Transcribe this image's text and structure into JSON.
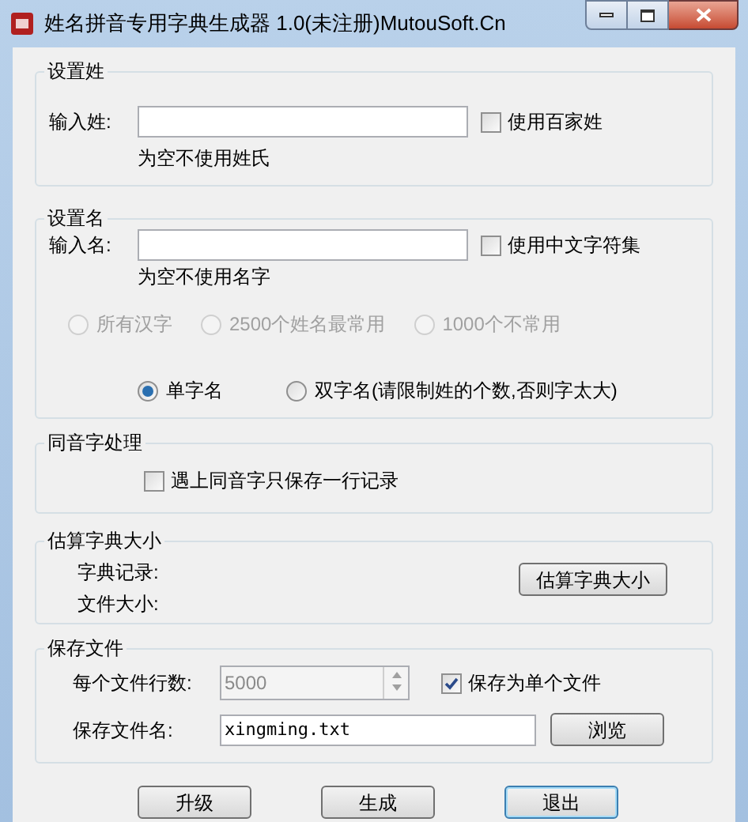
{
  "window": {
    "title": "姓名拼音专用字典生成器 1.0(未注册)MutouSoft.Cn"
  },
  "surname": {
    "title": "设置姓",
    "label": "输入姓:",
    "hint": "为空不使用姓氏",
    "checkbox": {
      "label": "使用百家姓",
      "checked": false
    }
  },
  "given_name": {
    "title": "设置名",
    "label": "输入名:",
    "hint": "为空不使用名字",
    "checkbox": {
      "label": "使用中文字符集",
      "checked": false
    },
    "charset_options": [
      {
        "label": "所有汉字",
        "selected": false,
        "disabled": true
      },
      {
        "label": "2500个姓名最常用",
        "selected": false,
        "disabled": true
      },
      {
        "label": "1000个不常用",
        "selected": false,
        "disabled": true
      }
    ],
    "length_options": [
      {
        "label": "单字名",
        "selected": true,
        "disabled": false
      },
      {
        "label": "双字名(请限制姓的个数,否则字太大)",
        "selected": false,
        "disabled": false
      }
    ]
  },
  "homophone": {
    "title": "同音字处理",
    "checkbox": {
      "label": "遇上同音字只保存一行记录",
      "checked": false
    }
  },
  "estimate": {
    "title": "估算字典大小",
    "rows": [
      {
        "label": "字典记录:"
      },
      {
        "label": "文件大小:"
      }
    ],
    "button": "估算字典大小"
  },
  "save": {
    "title": "保存文件",
    "lines_label": "每个文件行数:",
    "lines_value": "5000",
    "lines_disabled": true,
    "single_file": {
      "label": "保存为单个文件",
      "checked": true
    },
    "filename_label": "保存文件名:",
    "filename_value": "xingming.txt",
    "browse_button": "浏览"
  },
  "buttons": [
    {
      "label": "升级",
      "focused": false
    },
    {
      "label": "生成",
      "focused": false
    },
    {
      "label": "退出",
      "focused": true
    }
  ]
}
